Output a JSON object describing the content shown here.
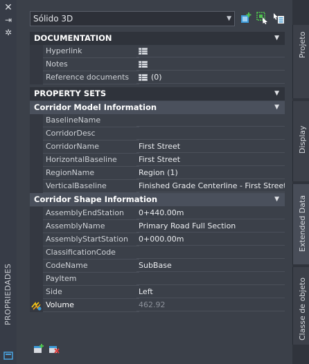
{
  "window": {
    "vertical_title": "PROPRIEDADES"
  },
  "selector": {
    "value": "Sólido 3D"
  },
  "sections": {
    "documentation": {
      "title": "DOCUMENTATION",
      "rows": [
        {
          "name": "Hyperlink",
          "value": ""
        },
        {
          "name": "Notes",
          "value": ""
        },
        {
          "name": "Reference documents",
          "value": "(0)"
        }
      ]
    },
    "property_sets": {
      "title": "PROPERTY SETS"
    },
    "corridor_model": {
      "title": "Corridor Model Information",
      "rows": [
        {
          "name": "BaselineName",
          "value": ""
        },
        {
          "name": "CorridorDesc",
          "value": ""
        },
        {
          "name": "CorridorName",
          "value": "First Street"
        },
        {
          "name": "HorizontalBaseline",
          "value": "First Street"
        },
        {
          "name": "RegionName",
          "value": "Region (1)"
        },
        {
          "name": "VerticalBaseline",
          "value": "Finished Grade Centerline - First Street"
        }
      ]
    },
    "corridor_shape": {
      "title": "Corridor Shape Information",
      "rows": [
        {
          "name": "AssemblyEndStation",
          "value": "0+440.00m"
        },
        {
          "name": "AssemblyName",
          "value": "Primary Road Full Section"
        },
        {
          "name": "AssemblyStartStation",
          "value": "0+000.00m"
        },
        {
          "name": "ClassificationCode",
          "value": ""
        },
        {
          "name": "CodeName",
          "value": "SubBase"
        },
        {
          "name": "PayItem",
          "value": ""
        },
        {
          "name": "Side",
          "value": "Left"
        },
        {
          "name": "Volume",
          "value": "462.92"
        }
      ]
    }
  },
  "right_tabs": [
    {
      "label": "Projeto"
    },
    {
      "label": "Display"
    },
    {
      "label": "Extended Data"
    },
    {
      "label": "Classe de objeto"
    }
  ],
  "icons": {
    "close": "close-icon",
    "autohide": "pin-icon",
    "settings": "gear-icon",
    "table": "table-icon",
    "volume": "lightning-icon"
  },
  "colors": {
    "panel_bg": "#3b4049",
    "section_header_bg": "#2f333b",
    "subsection_header_bg": "#4a505c",
    "toolbar_accent": "#3c9ad8",
    "toolbar_green": "#4fc24f"
  }
}
